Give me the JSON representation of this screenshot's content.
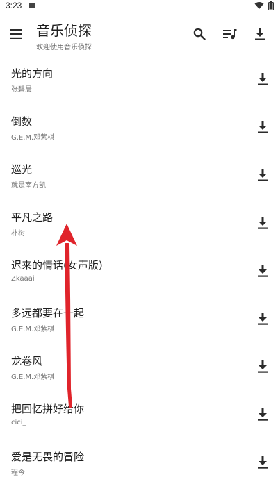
{
  "status_bar": {
    "time": "3:23"
  },
  "app_bar": {
    "title": "音乐侦探",
    "subtitle": "欢迎使用音乐侦探"
  },
  "songs": [
    {
      "title": "光的方向",
      "artist": "张碧晨"
    },
    {
      "title": "倒数",
      "artist": "G.E.M.邓紫棋"
    },
    {
      "title": "巡光",
      "artist": "就是南方凯"
    },
    {
      "title": "平凡之路",
      "artist": "朴树"
    },
    {
      "title": "迟来的情话(女声版)",
      "artist": "Zkaaai"
    },
    {
      "title": "多远都要在一起",
      "artist": "G.E.M.邓紫棋"
    },
    {
      "title": "龙卷风",
      "artist": "G.E.M.邓紫棋"
    },
    {
      "title": "把回忆拼好给你",
      "artist": "cici_"
    },
    {
      "title": "爱是无畏的冒险",
      "artist": "程今"
    }
  ],
  "colors": {
    "annotation_arrow": "#e0242b",
    "icon": "#2b2b2b"
  },
  "icons": {
    "menu": "menu-icon",
    "search": "search-icon",
    "playlist": "playlist-music-icon",
    "download": "download-icon"
  }
}
